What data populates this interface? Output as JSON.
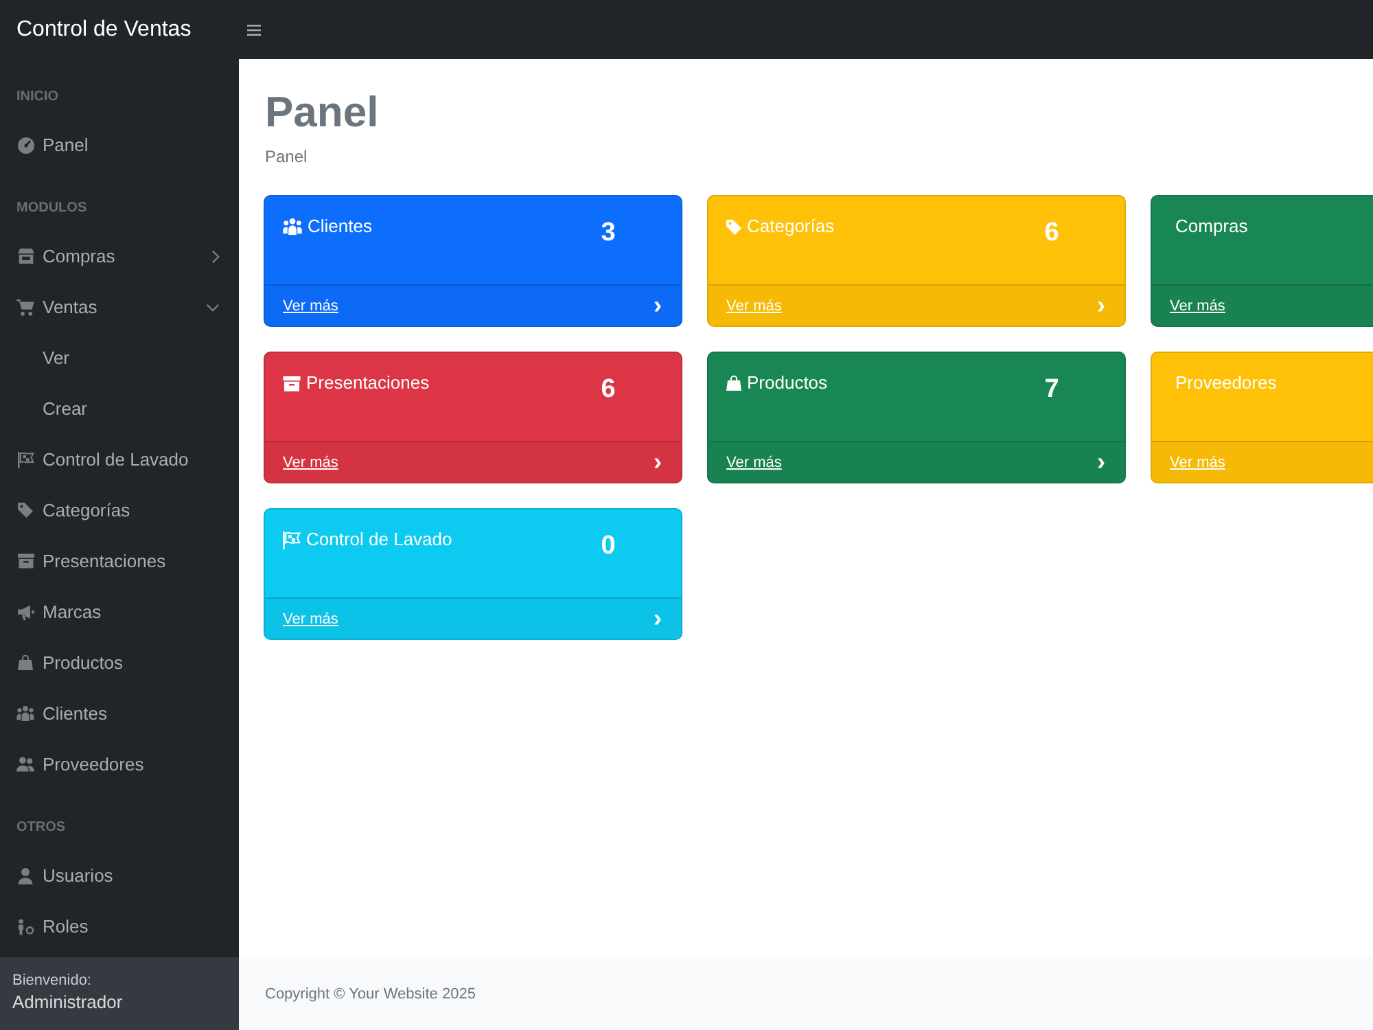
{
  "navbar": {
    "brand": "Control de Ventas"
  },
  "sidebar": {
    "sections": [
      {
        "heading": "INICIO",
        "items": [
          {
            "label": "Panel"
          }
        ]
      },
      {
        "heading": "MODULOS",
        "items": [
          {
            "label": "Compras",
            "expanded": false
          },
          {
            "label": "Ventas",
            "expanded": true,
            "children": [
              {
                "label": "Ver"
              },
              {
                "label": "Crear"
              }
            ]
          },
          {
            "label": "Control de Lavado"
          },
          {
            "label": "Categorías"
          },
          {
            "label": "Presentaciones"
          },
          {
            "label": "Marcas"
          },
          {
            "label": "Productos"
          },
          {
            "label": "Clientes"
          },
          {
            "label": "Proveedores"
          }
        ]
      },
      {
        "heading": "OTROS",
        "items": [
          {
            "label": "Usuarios"
          },
          {
            "label": "Roles"
          }
        ]
      }
    ],
    "footer": {
      "greeting": "Bienvenido:",
      "user": "Administrador"
    }
  },
  "main": {
    "title": "Panel",
    "breadcrumb": "Panel",
    "cards": [
      {
        "label": "Clientes",
        "count": "3",
        "color": "#0d6efd",
        "link": "Ver más",
        "arrow": "›"
      },
      {
        "label": "Categorías",
        "count": "6",
        "color": "#ffc107",
        "link": "Ver más",
        "arrow": "›"
      },
      {
        "label": "Compras",
        "color": "#198754",
        "link": "Ver más"
      },
      {
        "label": "Presentaciones",
        "count": "6",
        "color": "#dc3545",
        "link": "Ver más",
        "arrow": "›"
      },
      {
        "label": "Productos",
        "count": "7",
        "color": "#198754",
        "link": "Ver más",
        "arrow": "›"
      },
      {
        "label": "Proveedores",
        "color": "#ffc107",
        "link": "Ver más"
      },
      {
        "label": "Control de Lavado",
        "count": "0",
        "color": "#0dcaf0",
        "link": "Ver más",
        "arrow": "›"
      }
    ],
    "footer": {
      "copyright": "Copyright © Your Website 2025"
    }
  }
}
